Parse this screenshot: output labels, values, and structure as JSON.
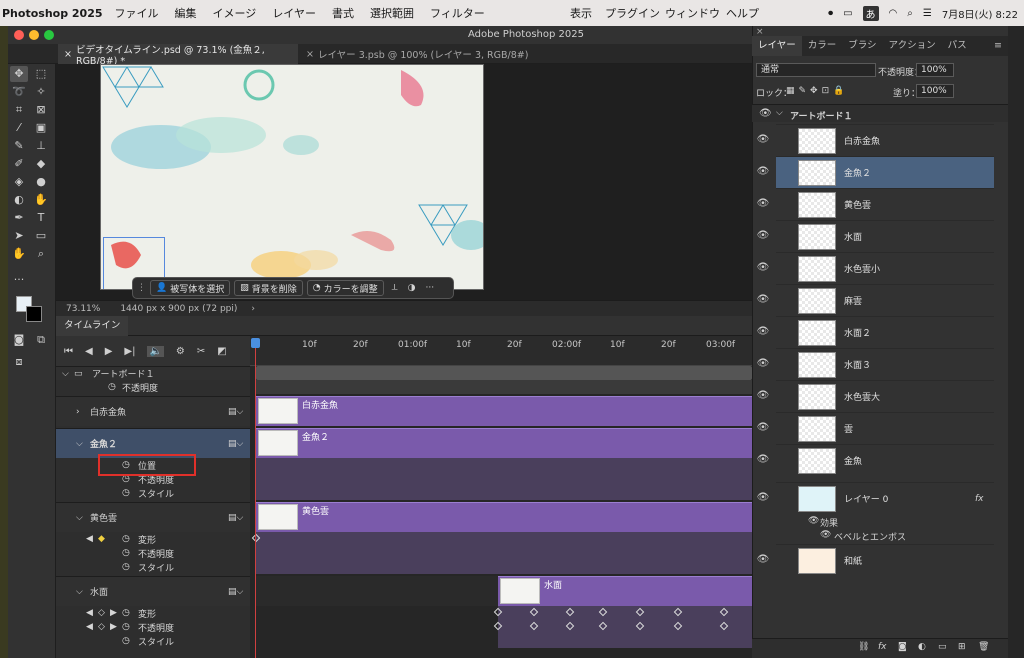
{
  "menubar": {
    "app": "Photoshop 2025",
    "items": [
      "ファイル",
      "編集",
      "イメージ",
      "レイヤー",
      "書式",
      "選択範囲",
      "フィルター"
    ],
    "right_items": [
      "表示",
      "プラグイン",
      "ウィンドウ",
      "ヘルプ"
    ],
    "ime": "あ",
    "datetime": "7月8日(火) 8:22"
  },
  "window": {
    "title": "Adobe Photoshop 2025"
  },
  "doc_tabs": [
    {
      "label": "ビデオタイムライン.psd @ 73.1% (金魚２, RGB/8#) *",
      "active": true
    },
    {
      "label": "レイヤー 3.psb @ 100% (レイヤー 3, RGB/8#)",
      "active": false
    }
  ],
  "context_bar": {
    "select_subject": "被写体を選択",
    "remove_bg": "背景を削除",
    "adjust_color": "カラーを調整"
  },
  "status": {
    "zoom": "73.11%",
    "doc_info": "1440 px x 900 px (72 ppi)"
  },
  "timeline": {
    "tab": "タイムライン",
    "ruler": [
      "10f",
      "20f",
      "01:00f",
      "10f",
      "20f",
      "02:00f",
      "10f",
      "20f",
      "03:00f"
    ],
    "artboard": "アートボード１",
    "opacity_label": "不透明度",
    "rows": {
      "hakin": "白赤金魚",
      "kingyo2": "金魚２",
      "position": "位置",
      "opacity": "不透明度",
      "style": "スタイル",
      "kiiro": "黄色雲",
      "transform": "変形",
      "opacity2": "不透明度",
      "style2": "スタイル",
      "suimen": "水面",
      "transform3": "変形",
      "opacity3": "不透明度",
      "style3": "スタイル"
    }
  },
  "layers_panel": {
    "tabs": [
      "レイヤー",
      "カラー",
      "ブラシ",
      "アクション",
      "パス"
    ],
    "blend_mode": "通常",
    "opacity_label": "不透明度：",
    "opacity_value": "100%",
    "lock_label": "ロック：",
    "fill_label": "塗り：",
    "fill_value": "100%",
    "artboard": "アートボード１",
    "layers": [
      "白赤金魚",
      "金魚２",
      "黄色雲",
      "水面",
      "水色雲小",
      "麻雲",
      "水面２",
      "水面３",
      "水色雲大",
      "雲",
      "金魚",
      "レイヤー 0",
      "和紙"
    ],
    "effects_label": "効果",
    "bevel_label": "ベベルとエンボス",
    "fx_label": "fx"
  },
  "colors": {
    "accent": "#7a5aab",
    "selected_layer": "#4a6280",
    "highlight": "#e0302a"
  }
}
